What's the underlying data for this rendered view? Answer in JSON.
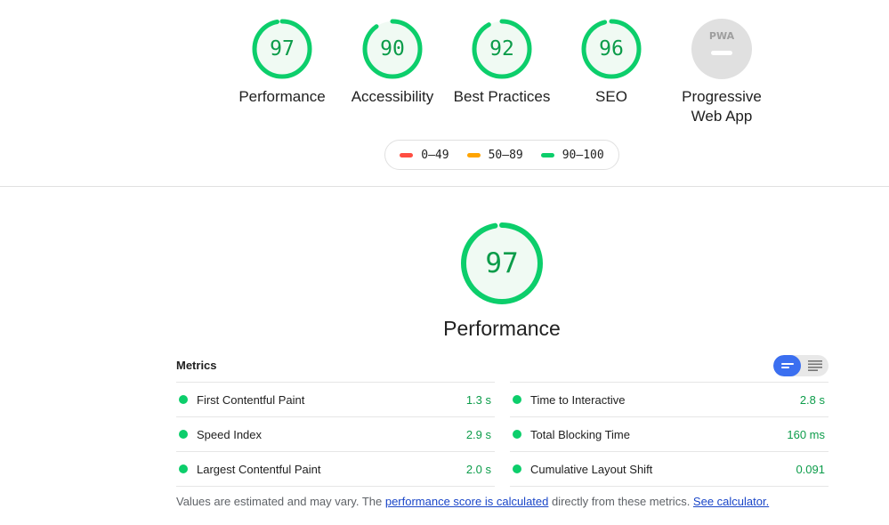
{
  "colors": {
    "pass": "#0cce6b",
    "pass_text": "#0c9c4a",
    "average": "#ffa400",
    "fail": "#ff4e42",
    "toggle_active": "#3b6ff0",
    "pwa_gray": "#e0e0e0"
  },
  "gauges": [
    {
      "score": "97",
      "label": "Performance",
      "value": 97
    },
    {
      "score": "90",
      "label": "Accessibility",
      "value": 90
    },
    {
      "score": "92",
      "label": "Best Practices",
      "value": 92
    },
    {
      "score": "96",
      "label": "SEO",
      "value": 96
    },
    {
      "badge": "PWA",
      "label_line1": "Progressive",
      "label_line2": "Web App"
    }
  ],
  "legend": [
    {
      "range": "0–49",
      "color": "#ff4e42"
    },
    {
      "range": "50–89",
      "color": "#ffa400"
    },
    {
      "range": "90–100",
      "color": "#0cce6b"
    }
  ],
  "main": {
    "score": "97",
    "value": 97,
    "label": "Performance"
  },
  "metrics": {
    "title": "Metrics",
    "toggle_icons": [
      "compact-view-icon",
      "expanded-view-icon"
    ],
    "left": [
      {
        "name": "First Contentful Paint",
        "value": "1.3 s"
      },
      {
        "name": "Speed Index",
        "value": "2.9 s"
      },
      {
        "name": "Largest Contentful Paint",
        "value": "2.0 s"
      }
    ],
    "right": [
      {
        "name": "Time to Interactive",
        "value": "2.8 s"
      },
      {
        "name": "Total Blocking Time",
        "value": "160 ms"
      },
      {
        "name": "Cumulative Layout Shift",
        "value": "0.091"
      }
    ]
  },
  "footnote": {
    "text1": "Values are estimated and may vary. The ",
    "link1": "performance score is calculated",
    "text2": " directly from these metrics. ",
    "link2": "See calculator."
  }
}
